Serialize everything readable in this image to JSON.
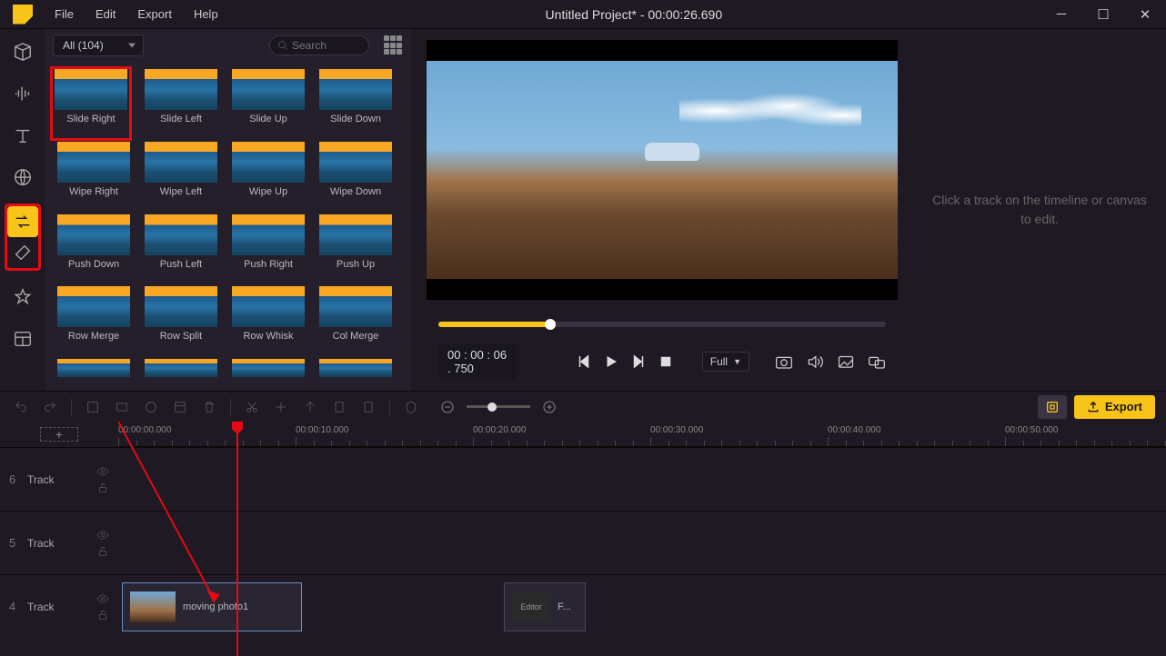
{
  "title": "Untitled Project* - 00:00:26.690",
  "menu": [
    "File",
    "Edit",
    "Export",
    "Help"
  ],
  "sidebar": [
    "media",
    "audio",
    "text",
    "effect",
    "transition",
    "overlay",
    "favorite",
    "layout"
  ],
  "filter": {
    "label": "All (104)"
  },
  "search_placeholder": "Search",
  "transitions": [
    {
      "label": "Slide Right",
      "sel": true
    },
    {
      "label": "Slide Left"
    },
    {
      "label": "Slide Up"
    },
    {
      "label": "Slide Down"
    },
    {
      "label": "Wipe Right"
    },
    {
      "label": "Wipe Left"
    },
    {
      "label": "Wipe Up"
    },
    {
      "label": "Wipe Down"
    },
    {
      "label": "Push Down"
    },
    {
      "label": "Push Left"
    },
    {
      "label": "Push Right"
    },
    {
      "label": "Push Up"
    },
    {
      "label": "Row Merge"
    },
    {
      "label": "Row Split"
    },
    {
      "label": "Row Whisk"
    },
    {
      "label": "Col Merge"
    }
  ],
  "timecode": "00 : 00 : 06 . 750",
  "res": "Full",
  "inspector_hint": "Click a track on the timeline or canvas to edit.",
  "export_label": "Export",
  "ruler": [
    "00:00:00.000",
    "00:00:10.000",
    "00:00:20.000",
    "00:00:30.000",
    "00:00:40.000",
    "00:00:50.000"
  ],
  "tracks": [
    {
      "num": "6",
      "name": "Track"
    },
    {
      "num": "5",
      "name": "Track"
    },
    {
      "num": "4",
      "name": "Track"
    }
  ],
  "clips": [
    {
      "label": "moving photo1"
    },
    {
      "label": "F...",
      "editor": "Editor"
    }
  ]
}
